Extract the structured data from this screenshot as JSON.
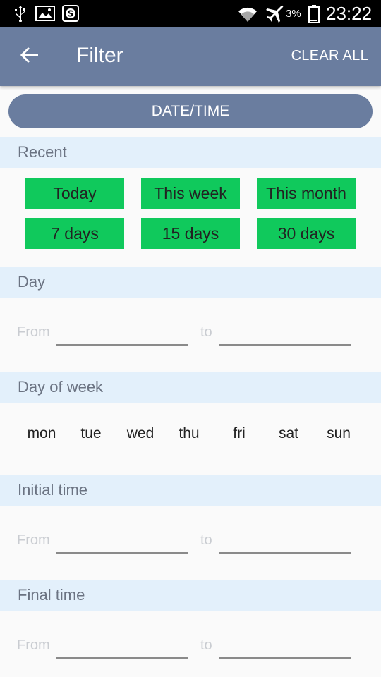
{
  "status_bar": {
    "battery_percent": "3%",
    "time": "23:22",
    "icons": [
      "usb-icon",
      "image-icon",
      "s-app-icon",
      "wifi-icon",
      "airplane-icon",
      "battery-icon"
    ]
  },
  "app_bar": {
    "back_icon": "arrow-left-icon",
    "title": "Filter",
    "clear_all": "CLEAR ALL"
  },
  "datetime_tab": "DATE/TIME",
  "recent": {
    "header": "Recent",
    "buttons": [
      "Today",
      "This week",
      "This month",
      "7 days",
      "15 days",
      "30 days"
    ]
  },
  "day": {
    "header": "Day",
    "from_label": "From",
    "to_label": "to",
    "from_value": "",
    "to_value": ""
  },
  "day_of_week": {
    "header": "Day of week",
    "days": [
      "mon",
      "tue",
      "wed",
      "thu",
      "fri",
      "sat",
      "sun"
    ]
  },
  "initial_time": {
    "header": "Initial time",
    "from_label": "From",
    "to_label": "to",
    "from_value": "",
    "to_value": ""
  },
  "final_time": {
    "header": "Final time",
    "from_label": "From",
    "to_label": "to",
    "from_value": "",
    "to_value": ""
  },
  "colors": {
    "primary": "#6a7d9f",
    "section_bg": "#e3f0fb",
    "quick_button": "#10c95c"
  }
}
